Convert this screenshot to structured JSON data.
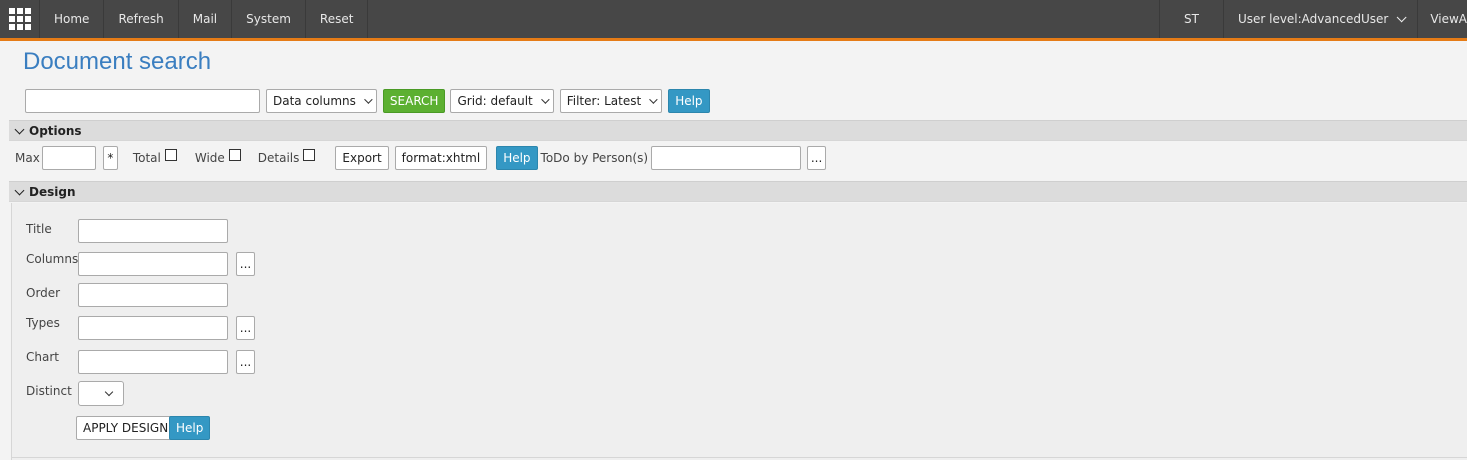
{
  "nav": {
    "items": [
      "Home",
      "Refresh",
      "Mail",
      "System",
      "Reset"
    ],
    "user_initials": "ST",
    "user_level": "User level:AdvancedUser",
    "view_cut": "ViewA"
  },
  "page": {
    "title": "Document search"
  },
  "search": {
    "query_value": "",
    "columns_label": "Data columns",
    "search_label": "SEARCH",
    "grid_label": "Grid: default",
    "filter_label": "Filter: Latest",
    "help_label": "Help"
  },
  "options": {
    "header": "Options",
    "max_label": "Max",
    "max_value": "",
    "star_label": "*",
    "total_label": "Total",
    "wide_label": "Wide",
    "details_label": "Details",
    "export_label": "Export",
    "format_label": "format:xhtml",
    "help_label": "Help",
    "todo_label": "ToDo by Person(s)",
    "todo_value": "",
    "dots_label": "..."
  },
  "design": {
    "header": "Design",
    "title_label": "Title",
    "columns_label": "Columns",
    "order_label": "Order",
    "types_label": "Types",
    "chart_label": "Chart",
    "distinct_label": "Distinct",
    "dots_label": "...",
    "apply_label": "APPLY DESIGN",
    "help_label": "Help"
  },
  "colors": {
    "topbar": "#474747",
    "accent_orange": "#e57b16",
    "title_blue": "#3a7ec0",
    "search_green": "#5cb031",
    "help_blue": "#3498c4"
  }
}
